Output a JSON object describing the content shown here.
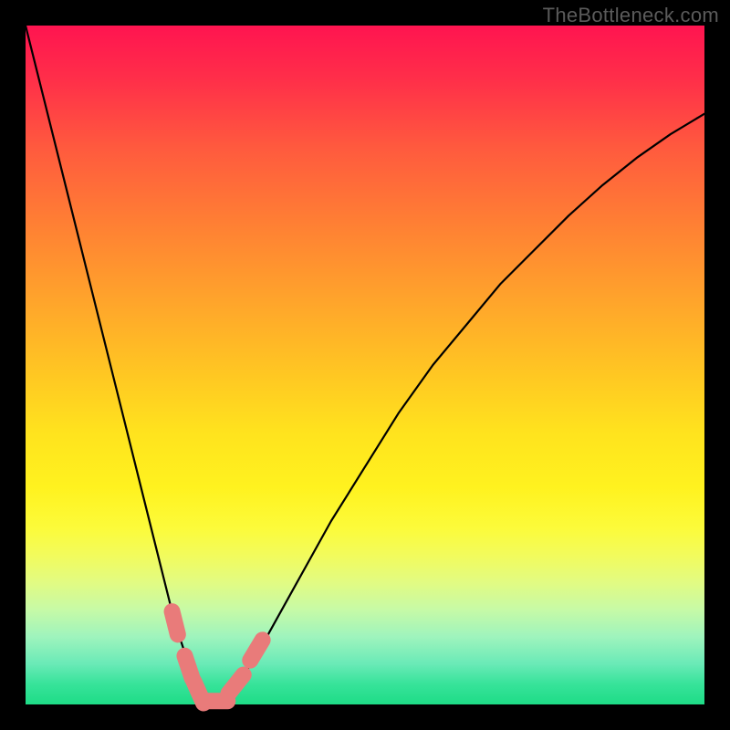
{
  "watermark": "TheBottleneck.com",
  "chart_data": {
    "type": "line",
    "title": "",
    "xlabel": "",
    "ylabel": "",
    "xlim": [
      0,
      100
    ],
    "ylim": [
      0,
      100
    ],
    "grid": false,
    "legend": false,
    "series": [
      {
        "name": "curve",
        "x": [
          0,
          3,
          6,
          9,
          12,
          15,
          18,
          20,
          22,
          24,
          26,
          27,
          28,
          30,
          32,
          35,
          40,
          45,
          50,
          55,
          60,
          65,
          70,
          75,
          80,
          85,
          90,
          95,
          100
        ],
        "y": [
          100,
          88,
          76,
          64,
          52,
          40,
          28,
          20,
          12,
          6,
          1.5,
          0.5,
          0.5,
          1.5,
          4,
          9,
          18,
          27,
          35,
          43,
          50,
          56,
          62,
          67,
          72,
          76.5,
          80.5,
          84,
          87
        ]
      }
    ],
    "markers": [
      {
        "x": 22.0,
        "y": 12.0,
        "kind": "pill"
      },
      {
        "x": 24.0,
        "y": 5.5,
        "kind": "pill"
      },
      {
        "x": 25.5,
        "y": 1.8,
        "kind": "pill"
      },
      {
        "x": 28.0,
        "y": 0.5,
        "kind": "pill"
      },
      {
        "x": 31.0,
        "y": 3.0,
        "kind": "pill"
      },
      {
        "x": 34.0,
        "y": 8.0,
        "kind": "pill"
      }
    ],
    "colors": {
      "curve": "#000000",
      "marker": "#e97b7a",
      "gradient_top": "#ff1450",
      "gradient_bottom": "#1edc86"
    }
  }
}
